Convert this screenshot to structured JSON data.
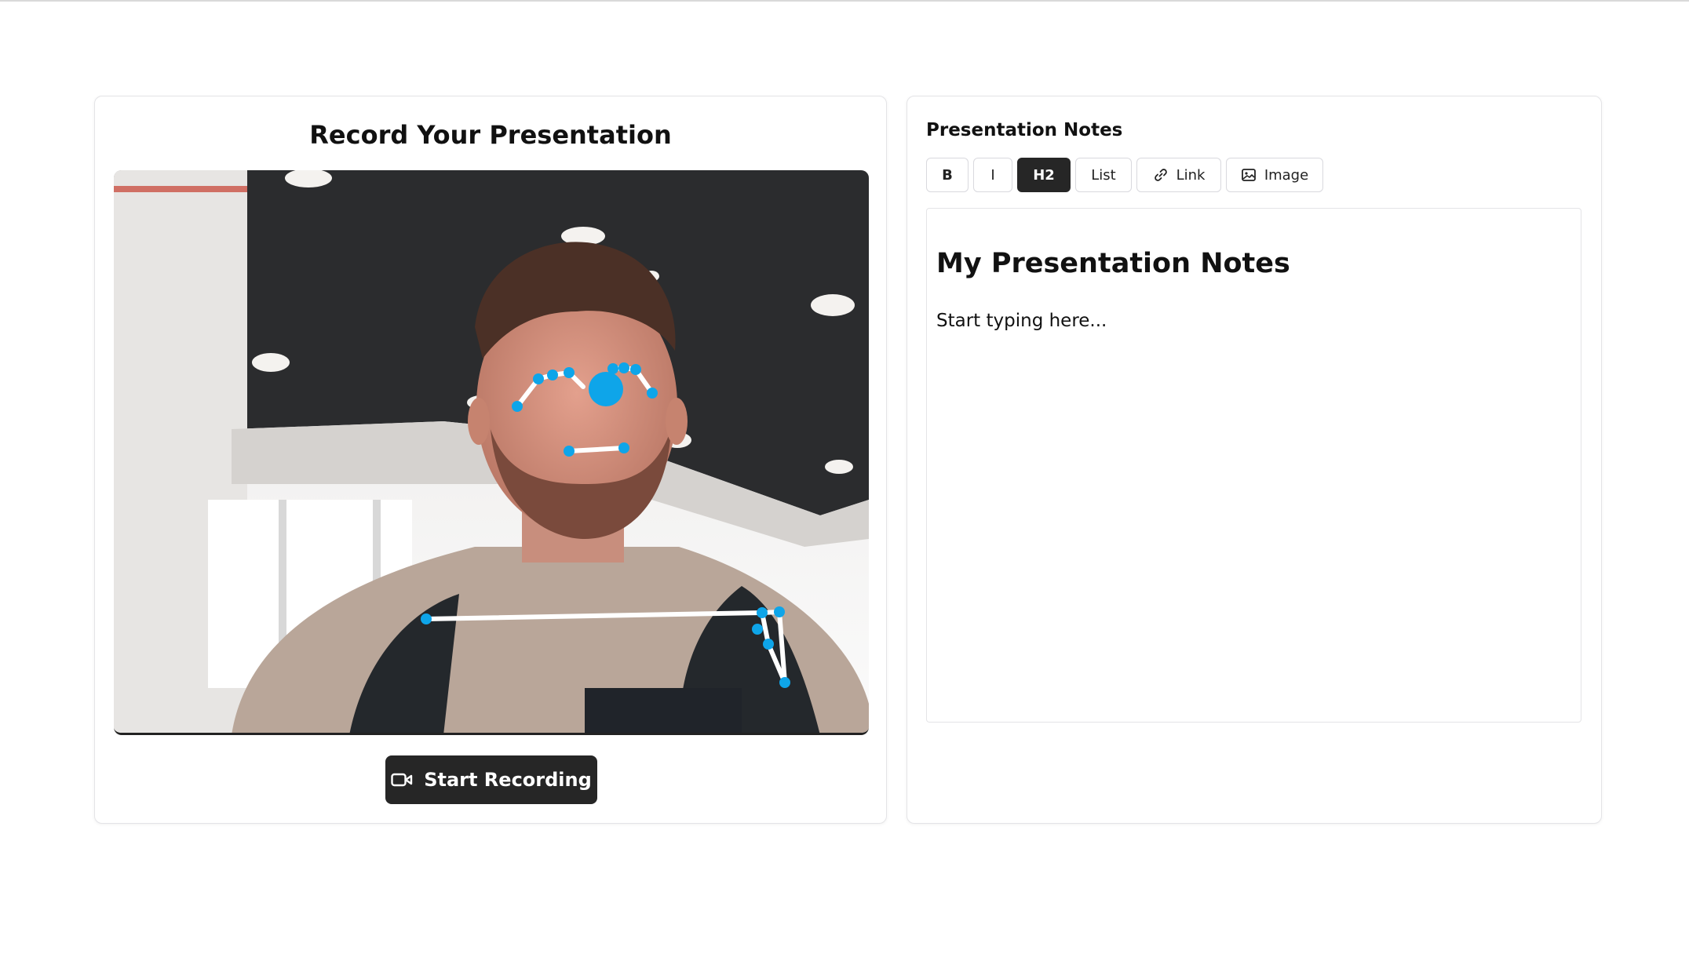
{
  "recorder": {
    "title": "Record Your Presentation",
    "record_button_label": "Start Recording",
    "record_button_icon": "video-camera-icon",
    "pose_overlay_color": "#0ea5e9"
  },
  "notes": {
    "title": "Presentation Notes",
    "toolbar": {
      "bold": "B",
      "italic": "I",
      "h2": "H2",
      "list": "List",
      "link": "Link",
      "image": "Image",
      "active": "H2"
    },
    "editor": {
      "heading": "My Presentation Notes",
      "paragraph": "Start typing here..."
    }
  },
  "colors": {
    "primary_button": "#262626",
    "border": "#e4e4e7"
  }
}
